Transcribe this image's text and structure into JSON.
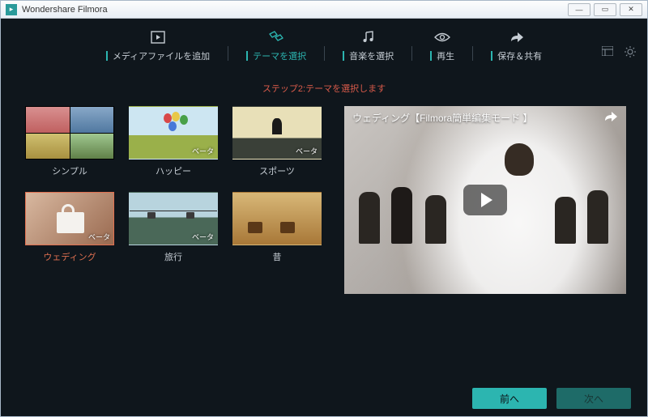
{
  "window": {
    "title": "Wondershare Filmora"
  },
  "nav": {
    "items": [
      {
        "label": "メディアファイルを追加"
      },
      {
        "label": "テーマを選択"
      },
      {
        "label": "音楽を選択"
      },
      {
        "label": "再生"
      },
      {
        "label": "保存＆共有"
      }
    ],
    "active_index": 1
  },
  "step_line": "ステップ2:テーマを選択します",
  "themes": [
    {
      "id": "simple",
      "label": "シンプル",
      "beta": false
    },
    {
      "id": "happy",
      "label": "ハッピー",
      "beta": true
    },
    {
      "id": "sports",
      "label": "スポーツ",
      "beta": true
    },
    {
      "id": "wedding",
      "label": "ウェディング",
      "beta": true
    },
    {
      "id": "travel",
      "label": "旅行",
      "beta": true
    },
    {
      "id": "old",
      "label": "昔",
      "beta": false
    }
  ],
  "selected_theme_index": 3,
  "beta_label": "ベータ",
  "preview": {
    "title": "ウェディング【Filmora簡単編集モード 】"
  },
  "footer": {
    "prev": "前へ",
    "next": "次へ"
  }
}
